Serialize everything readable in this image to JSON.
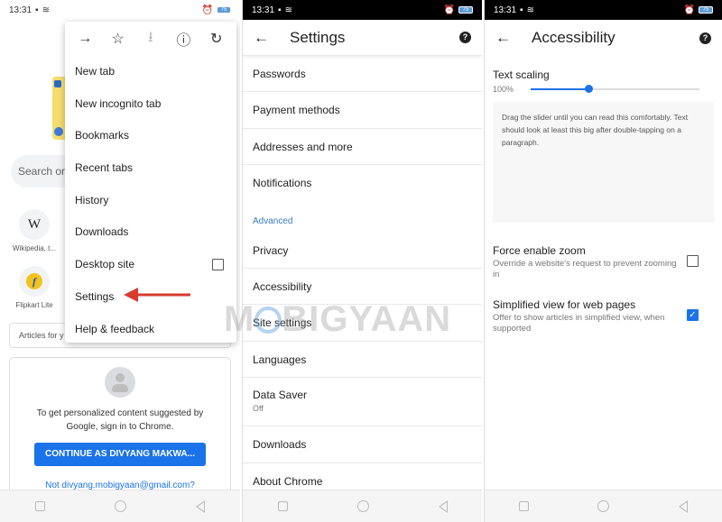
{
  "status_bar": {
    "time": "13:31",
    "battery": "75"
  },
  "panel1": {
    "search_placeholder": "Search or",
    "tiles": [
      {
        "label": "Wikipedia, t...",
        "icon": "W"
      },
      {
        "label": "Flipkart Lite",
        "icon": "f"
      }
    ],
    "articles_label": "Articles for y",
    "signin_card": {
      "message": "To get personalized content suggested by Google, sign in to Chrome.",
      "continue_button": "CONTINUE AS DIVYANG MAKWA...",
      "not_you_link": "Not divyang.mobigyaan@gmail.com?"
    },
    "menu": {
      "toolbar_icons": [
        "forward-icon",
        "bookmark-star-icon",
        "download-icon",
        "info-icon",
        "reload-icon"
      ],
      "items": [
        "New tab",
        "New incognito tab",
        "Bookmarks",
        "Recent tabs",
        "History",
        "Downloads",
        "Desktop site",
        "Settings",
        "Help & feedback"
      ],
      "desktop_site_checked": false
    }
  },
  "panel2": {
    "title": "Settings",
    "items": [
      "Passwords",
      "Payment methods",
      "Addresses and more",
      "Notifications"
    ],
    "section_header": "Advanced",
    "advanced_items": [
      "Privacy",
      "Accessibility",
      "Site settings",
      "Languages"
    ],
    "data_saver": {
      "label": "Data Saver",
      "value": "Off"
    },
    "bottom_items": [
      "Downloads",
      "About Chrome"
    ],
    "watermark": "MOBIGYAAN"
  },
  "panel3": {
    "title": "Accessibility",
    "text_scaling": {
      "label": "Text scaling",
      "value": "100%",
      "slider_fraction": 0.34
    },
    "preview_text": "Drag the slider until you can read this comfortably. Text should look at least this big after double-tapping on a paragraph.",
    "options": [
      {
        "title": "Force enable zoom",
        "subtitle": "Override a website's request to prevent zooming in",
        "checked": false
      },
      {
        "title": "Simplified view for web pages",
        "subtitle": "Offer to show articles in simplified view, when supported",
        "checked": true
      }
    ]
  },
  "colors": {
    "accent": "#1a73e8",
    "annotation_arrow": "#d93a2f",
    "section_header": "#3b78c4"
  }
}
